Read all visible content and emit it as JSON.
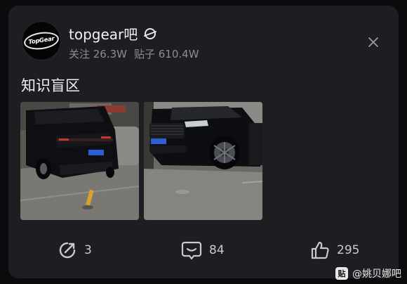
{
  "post": {
    "bar_name": "topgear吧",
    "avatar_text": "TopGear",
    "followers": "关注 26.3W",
    "posts": "贴子 610.4W",
    "title": "知识盲区"
  },
  "images": [
    {
      "alt": "black-suv-rear"
    },
    {
      "alt": "black-suv-front"
    }
  ],
  "actions": {
    "share_count": "3",
    "comment_count": "84",
    "like_count": "295"
  },
  "watermark": {
    "logo": "贴",
    "text": "@姚贝娜吧"
  },
  "colors": {
    "background": "#0b0b0d",
    "card": "#1e1e22",
    "text_primary": "#f2f2f4",
    "text_secondary": "#8c8c92"
  }
}
